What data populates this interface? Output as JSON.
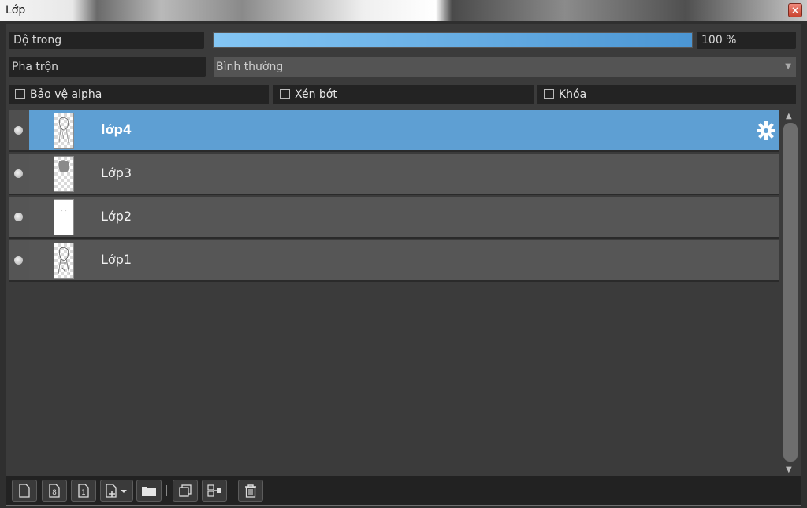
{
  "window": {
    "title": "Lớp",
    "close_label": "×"
  },
  "opacity": {
    "label": "Độ trong",
    "value": "100 %",
    "fill_fraction": 1.0
  },
  "blend": {
    "label": "Pha trộn",
    "selected": "Bình thường"
  },
  "options": [
    {
      "label": "Bảo vệ alpha",
      "checked": false
    },
    {
      "label": "Xén bớt",
      "checked": false
    },
    {
      "label": "Khóa",
      "checked": false
    }
  ],
  "layers": [
    {
      "name": "lớp4",
      "selected": true,
      "visible": true
    },
    {
      "name": "Lớp3",
      "selected": false,
      "visible": true
    },
    {
      "name": "Lớp2",
      "selected": false,
      "visible": true
    },
    {
      "name": "Lớp1",
      "selected": false,
      "visible": true
    }
  ],
  "toolbar": {
    "icons": [
      "new-layer-icon",
      "new-8bit-layer-icon",
      "new-1bit-layer-icon",
      "add-layer-dropdown-icon",
      "folder-icon",
      "duplicate-icon",
      "merge-down-icon",
      "trash-icon"
    ],
    "bit8_label": "8",
    "bit1_label": "1"
  },
  "colors": {
    "accent": "#5e9fd3",
    "row": "#565656",
    "panel": "#3b3b3b"
  }
}
